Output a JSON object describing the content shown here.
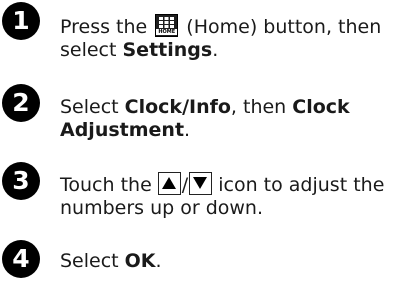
{
  "steps": [
    {
      "number": "1",
      "line1_a": "Press the ",
      "icon_label": "HOME",
      "line1_b": " (Home) button, then",
      "line2_a": "select ",
      "line2_bold": "Settings",
      "line2_end": "."
    },
    {
      "number": "2",
      "line1_a": "Select ",
      "line1_bold1": "Clock/Info",
      "line1_mid": ", then ",
      "line1_bold2": "Clock",
      "line2_bold": "Adjustment",
      "line2_end": "."
    },
    {
      "number": "3",
      "line1_a": "Touch the ",
      "slash": "/",
      "line1_b": " icon to adjust the",
      "line2": "numbers up or down."
    },
    {
      "number": "4",
      "line1_a": "Select ",
      "line1_bold": "OK",
      "line1_end": "."
    }
  ]
}
